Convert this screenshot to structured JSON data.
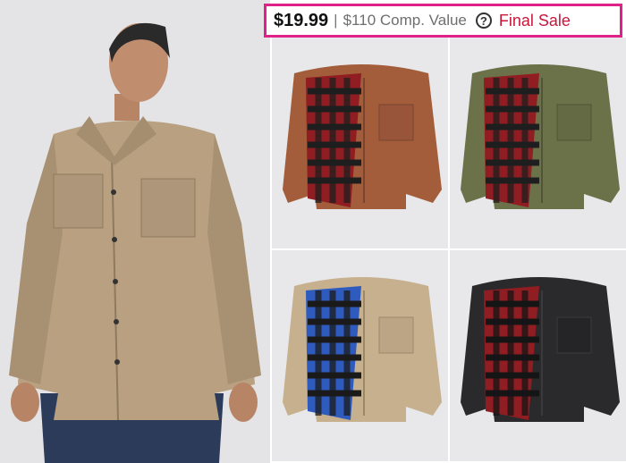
{
  "offer": {
    "price": "$19.99",
    "separator": "|",
    "comp_value": "$110 Comp. Value",
    "help_glyph": "?",
    "final_sale": "Final Sale",
    "highlight_color": "#e0218a",
    "final_sale_color": "#c8173a"
  },
  "variants": [
    {
      "shell": "brown",
      "lining": "red-black buffalo plaid"
    },
    {
      "shell": "olive green",
      "lining": "red-black buffalo plaid"
    },
    {
      "shell": "khaki",
      "lining": "blue-black buffalo plaid"
    },
    {
      "shell": "black",
      "lining": "red-black buffalo plaid"
    }
  ],
  "icons": {
    "help": "question-circle-icon"
  }
}
